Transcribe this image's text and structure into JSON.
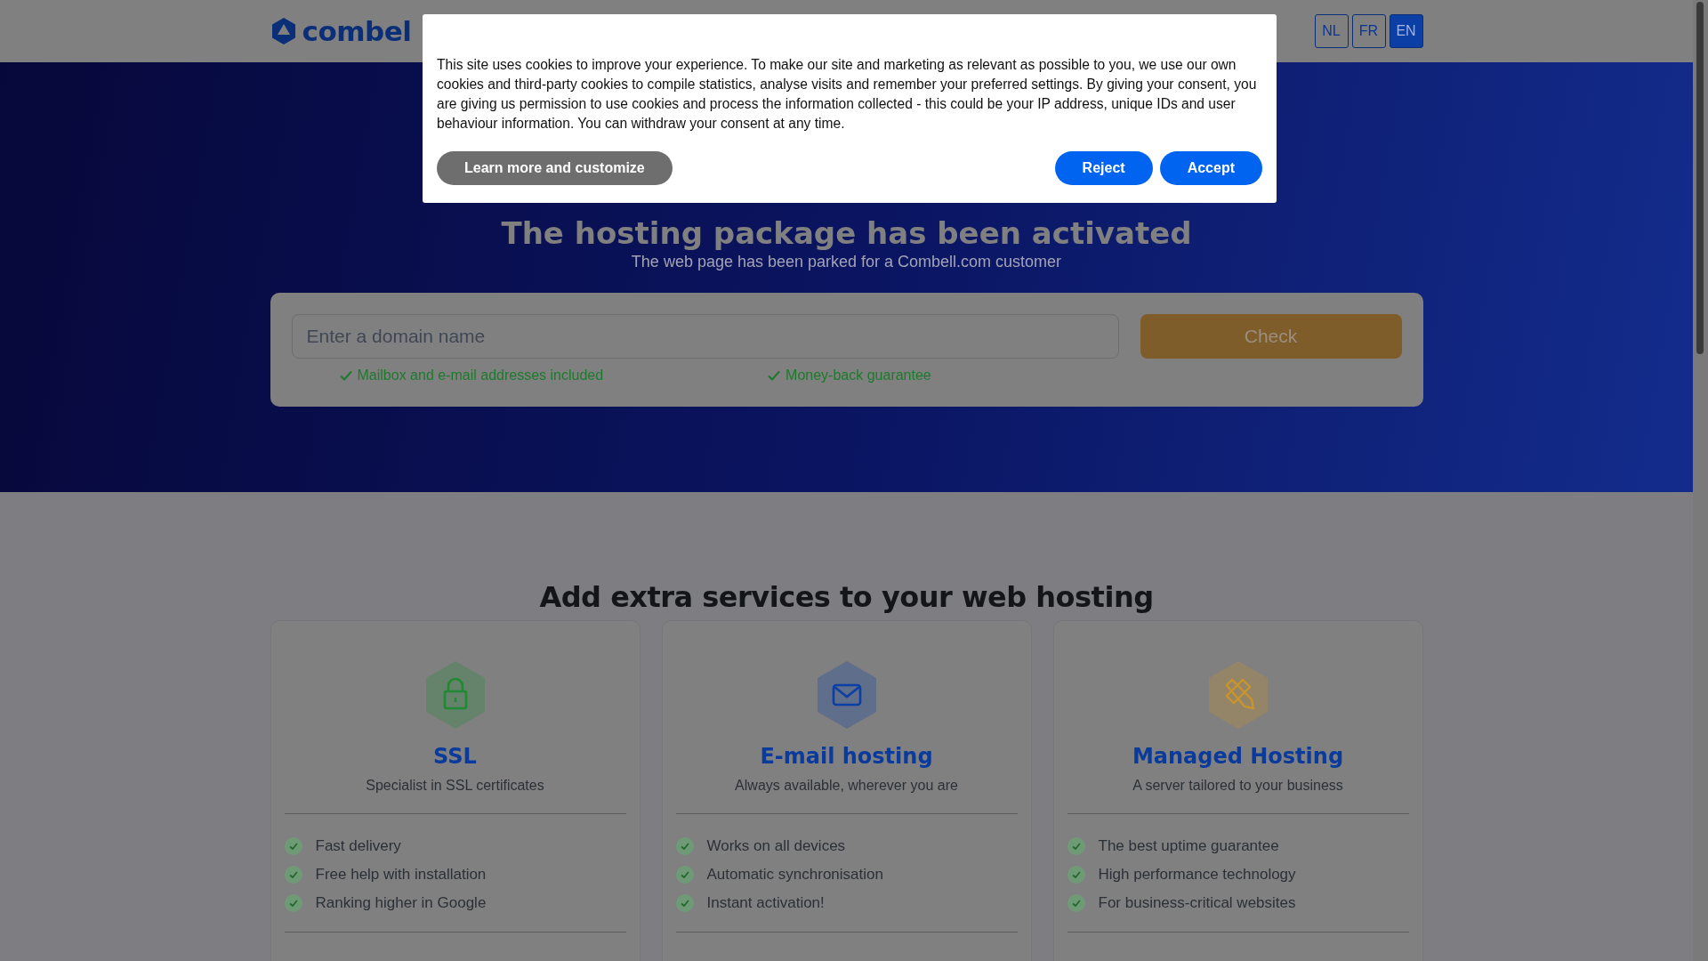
{
  "header": {
    "logo": "combel",
    "languages": [
      {
        "label": "NL",
        "selected": false
      },
      {
        "label": "FR",
        "selected": false
      },
      {
        "label": "EN",
        "selected": true
      }
    ]
  },
  "cookie_dialog": {
    "text": "This site uses cookies to improve your experience. To make our site and marketing as relevant as possible to you, we use our own cookies and third-party cookies to compile statistics, analyse visits and remember your preferred settings. By giving your consent, you are giving us permission to use cookies and process the information collected - this could be your IP address, unique IDs and user behaviour information. You can withdraw your consent at any time.",
    "buttons": [
      {
        "label": "Learn more and customize",
        "kind": "secondary"
      },
      {
        "label": "Reject",
        "kind": "primary"
      },
      {
        "label": "Accept",
        "kind": "primary"
      }
    ]
  },
  "hero": {
    "title": "The hosting package has been activated",
    "subtitle": "The web page has been parked for a Combell.com customer",
    "search": {
      "placeholder": "Enter a domain name",
      "button": "Check"
    },
    "features": [
      "Mailbox and e-mail addresses included",
      "Money-back guarantee"
    ]
  },
  "services": {
    "heading": "Add extra services to your web hosting",
    "cards": [
      {
        "kind": "lock",
        "color": "#1f8a34",
        "title": "SSL",
        "subtitle": "Specialist in SSL certificates",
        "items": [
          "Fast delivery",
          "Free help with installation",
          "Ranking higher in Google"
        ]
      },
      {
        "kind": "mail",
        "color": "#0b3fa6",
        "title": "E-mail hosting",
        "subtitle": "Always available, wherever you are",
        "items": [
          "Works on all devices",
          "Automatic synchronisation",
          "Instant activation!"
        ]
      },
      {
        "kind": "tools",
        "color": "#c8952c",
        "title": "Managed Hosting",
        "subtitle": "A server tailored to your business",
        "items": [
          "The best uptime guarantee",
          "High performance technology",
          "For business-critical websites"
        ]
      }
    ]
  }
}
